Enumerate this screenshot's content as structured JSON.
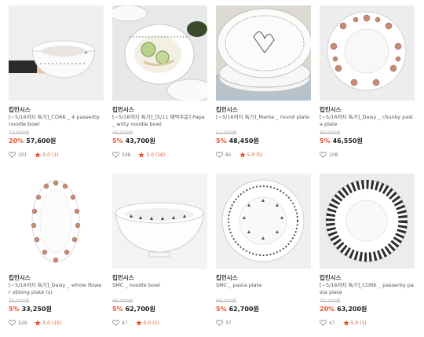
{
  "accent_color": "#e6522c",
  "products": [
    {
      "brand": "킵인시스",
      "name": "[~5/16까지 특가]_CORK _ 4 passerby noodle bowl",
      "orig": "72,000원",
      "disc": "20%",
      "price": "57,600원",
      "likes": "101",
      "rating": "5.0 (1)"
    },
    {
      "brand": "킵인시스",
      "name": "[~5/16까지 특가]_[5/11 예약주문] Papa _ witty noodle bowl",
      "orig": "46,000원",
      "disc": "5%",
      "price": "43,700원",
      "likes": "248",
      "rating": "5.0 (16)"
    },
    {
      "brand": "킵인시스",
      "name": "[~5/16까지 특가]_Mama _ round plate",
      "orig": "51,000원",
      "disc": "5%",
      "price": "48,450원",
      "likes": "85",
      "rating": "5.0 (5)"
    },
    {
      "brand": "킵인시스",
      "name": "[~5/16까지 특가]_Daisy _ chunky pasta plate",
      "orig": "49,000원",
      "disc": "5%",
      "price": "46,550원",
      "likes": "108",
      "rating": ""
    },
    {
      "brand": "킵인시스",
      "name": "[~5/16까지 특가]_Daisy _ whole flower oblong plate (s)",
      "orig": "35,000원",
      "disc": "5%",
      "price": "33,250원",
      "likes": "329",
      "rating": "5.0 (15)"
    },
    {
      "brand": "킵인시스",
      "name": "SMC _ noodle bowl",
      "orig": "66,000원",
      "disc": "5%",
      "price": "62,700원",
      "likes": "47",
      "rating": "5.0 (1)"
    },
    {
      "brand": "킵인시스",
      "name": "SMC _ pasta plate",
      "orig": "66,000원",
      "disc": "5%",
      "price": "62,700원",
      "likes": "37",
      "rating": ""
    },
    {
      "brand": "킵인시스",
      "name": "[~5/16까지 특가]_CORK _ passerby pasta plate",
      "orig": "79,000원",
      "disc": "20%",
      "price": "63,200원",
      "likes": "47",
      "rating": "5.0 (1)"
    }
  ]
}
